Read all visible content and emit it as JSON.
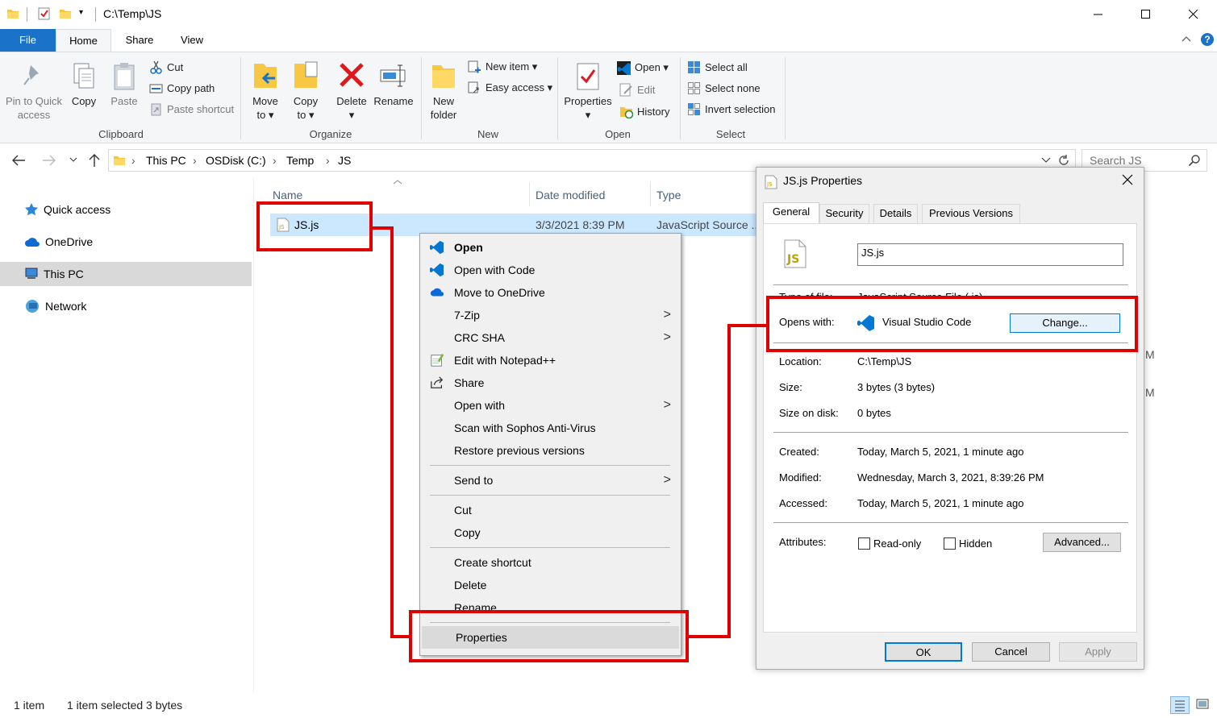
{
  "window": {
    "path": "C:\\Temp\\JS"
  },
  "ribbon_tabs": {
    "file": "File",
    "home": "Home",
    "share": "Share",
    "view": "View"
  },
  "ribbon": {
    "clipboard": {
      "pin": "Pin to Quick\naccess",
      "copy": "Copy",
      "paste": "Paste",
      "cut": "Cut",
      "copy_path": "Copy path",
      "paste_shortcut": "Paste shortcut",
      "label": "Clipboard"
    },
    "organize": {
      "move_to": "Move\nto ▾",
      "copy_to": "Copy\nto ▾",
      "delete": "Delete\n▾",
      "rename": "Rename",
      "label": "Organize"
    },
    "new": {
      "new_folder": "New\nfolder",
      "new_item": "New item ▾",
      "easy_access": "Easy access ▾",
      "label": "New"
    },
    "open": {
      "properties": "Properties\n▾",
      "open": "Open ▾",
      "edit": "Edit",
      "history": "History",
      "label": "Open"
    },
    "select": {
      "select_all": "Select all",
      "select_none": "Select none",
      "invert": "Invert selection",
      "label": "Select"
    }
  },
  "address": {
    "crumbs": [
      "This PC",
      "OSDisk (C:)",
      "Temp",
      "JS"
    ],
    "search_placeholder": "Search JS"
  },
  "nav": {
    "quick_access": "Quick access",
    "onedrive": "OneDrive",
    "this_pc": "This PC",
    "network": "Network"
  },
  "columns": {
    "name": "Name",
    "date": "Date modified",
    "type": "Type"
  },
  "file": {
    "name": "JS.js",
    "date": "3/3/2021 8:39 PM",
    "type": "JavaScript Source ..."
  },
  "context_menu": {
    "open": "Open",
    "open_code": "Open with Code",
    "onedrive": "Move to OneDrive",
    "zip": "7-Zip",
    "crc": "CRC SHA",
    "notepad": "Edit with Notepad++",
    "share": "Share",
    "open_with": "Open with",
    "sophos": "Scan with Sophos Anti-Virus",
    "restore": "Restore previous versions",
    "send_to": "Send to",
    "cut": "Cut",
    "copy": "Copy",
    "shortcut": "Create shortcut",
    "delete": "Delete",
    "rename": "Rename",
    "properties": "Properties"
  },
  "dialog": {
    "title": "JS.js Properties",
    "tabs": {
      "general": "General",
      "security": "Security",
      "details": "Details",
      "previous": "Previous Versions"
    },
    "filename": "JS.js",
    "type_label": "Type of file:",
    "type_value": "JavaScript Source File (.js)",
    "opens_label": "Opens with:",
    "opens_value": "Visual Studio Code",
    "change": "Change...",
    "location_label": "Location:",
    "location_value": "C:\\Temp\\JS",
    "size_label": "Size:",
    "size_value": "3 bytes (3 bytes)",
    "disk_label": "Size on disk:",
    "disk_value": "0 bytes",
    "created_label": "Created:",
    "created_value": "Today, March 5, 2021, 1 minute ago",
    "modified_label": "Modified:",
    "modified_value": "Wednesday, March 3, 2021, 8:39:26 PM",
    "accessed_label": "Accessed:",
    "accessed_value": "Today, March 5, 2021, 1 minute ago",
    "attr_label": "Attributes:",
    "readonly": "Read-only",
    "hidden": "Hidden",
    "advanced": "Advanced...",
    "ok": "OK",
    "cancel": "Cancel",
    "apply": "Apply"
  },
  "status": {
    "count": "1 item",
    "selected": "1 item selected  3 bytes"
  },
  "colors": {
    "highlight": "#e00000",
    "accent": "#1a73c8",
    "selection": "#cce8ff",
    "vscode": "#0078d4"
  }
}
